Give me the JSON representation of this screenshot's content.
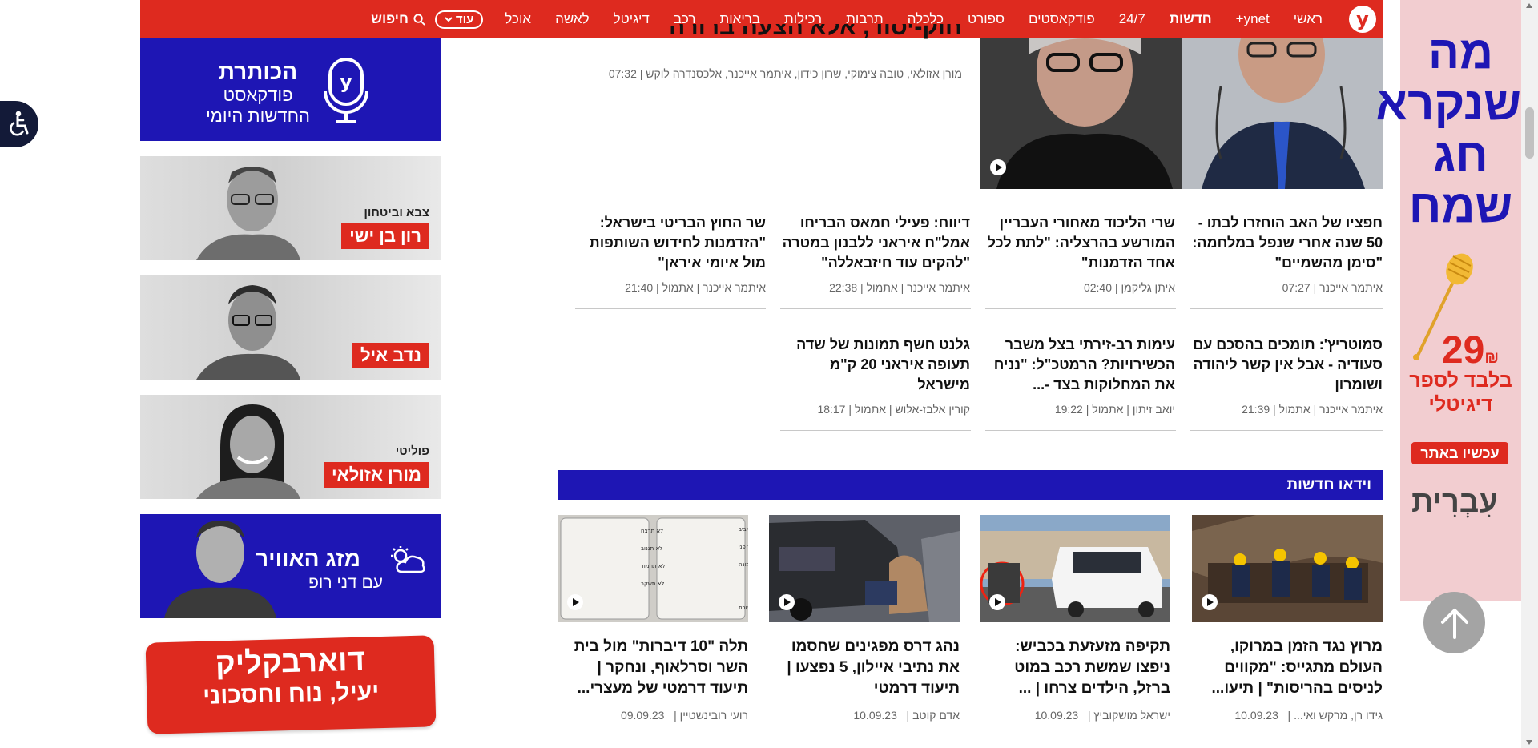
{
  "nav": {
    "logo": "y",
    "items": [
      "ראשי",
      "ynet+",
      "חדשות",
      "24/7",
      "פודקאסטים",
      "ספורט",
      "כלכלה",
      "תרבות",
      "רכילות",
      "בריאות",
      "רכב",
      "דיגיטל",
      "לאשה",
      "אוכל"
    ],
    "more": "עוד",
    "search": "חיפוש"
  },
  "lead": {
    "title": "חוק-יסוד, אלא הצעה ברורה",
    "authors": "מורן אזולאי, טובה צימוקי, שרון כידון, איתמר אייכנר, אלכסנדרה לוקש | 07:32"
  },
  "articles": [
    {
      "title": "חפציו של האב הוחזרו לבתו - 50 שנה אחרי שנפל במלחמה: \"סימן מהשמיים\"",
      "author": "איתמר אייכנר",
      "time": "07:27"
    },
    {
      "title": "שרי הליכוד מאחורי העבריין המורשע בהרצליה: \"לתת לכל אחד הזדמנות\"",
      "author": "איתן גליקמן",
      "time": "02:40"
    },
    {
      "title": "דיווח: פעילי חמאס הבריחו אמל\"ח איראני ללבנון במטרה \"להקים עוד חיזבאללה\"",
      "author": "איתמר אייכנר | אתמול",
      "time": "22:38"
    },
    {
      "title": "שר החוץ הבריטי בישראל: \"הזדמנות לחידוש השותפות מול איומי איראן\"",
      "author": "איתמר אייכנר | אתמול",
      "time": "21:40"
    },
    {
      "title": "סמוטריץ': תומכים בהסכם עם סעודיה - אבל אין קשר ליהודה ושומרון",
      "author": "איתמר אייכנר | אתמול",
      "time": "21:39"
    },
    {
      "title": "עימות רב-זירתי בצל משבר הכשירויות? הרמטכ\"ל: \"נניח את המחלוקות בצד -...",
      "author": "יואב זיתון | אתמול",
      "time": "19:22"
    },
    {
      "title": "גלנט חשף תמונות של שדה תעופה איראני 20 ק\"מ מישראל",
      "author": "קורין אלבז-אלוש | אתמול",
      "time": "18:17"
    }
  ],
  "video_section": {
    "title": "וידאו חדשות"
  },
  "videos": [
    {
      "title": "מרוץ נגד הזמן במרוקו, העולם מתגייס: \"מקווים לניסים בהריסות\" | תיעו...",
      "author": "גידו רן, מרקש ואי...",
      "date": "10.09.23"
    },
    {
      "title": "תקיפה מזעזעת בכביש: ניפצו שמשת רכב במוט ברזל, הילדים צרחו | ...",
      "author": "ישראל מושקוביץ",
      "date": "10.09.23"
    },
    {
      "title": "נהג דרס מפגינים שחסמו את נתיבי איילון, 5 נפצעו | תיעוד דרמטי",
      "author": "אדם קוטב",
      "date": "10.09.23"
    },
    {
      "title": "תלה \"10 דיברות\" מול בית השר וסרלאוף, ונחקר | תיעוד דרמטי של מעצרי...",
      "author": "רועי רובינשטיין",
      "date": "09.09.23"
    }
  ],
  "video_sign": {
    "left_lines": [
      "לא תרצח",
      "לא תגנוב",
      "לא תחמוד",
      "לא תשקר"
    ],
    "right_lines": [
      "אנוכי הצמון חייך, תל אביב",
      "לא יהיה לך משך אחד על פני",
      "עשה לך פסל ותמונה",
      "זכור את יום השבת"
    ]
  },
  "sidebar": {
    "podcast": {
      "title": "הכותרת",
      "line2": "פודקאסט",
      "line3": "החדשות היומי"
    },
    "columnists": [
      {
        "category": "צבא וביטחון",
        "name": "רון בן ישי"
      },
      {
        "category": "",
        "name": "נדב איל"
      },
      {
        "category": "פוליטי",
        "name": "מורן אזולאי"
      }
    ],
    "weather": {
      "title": "מזג האוויר",
      "subtitle": "עם דני רופ"
    },
    "dvr": {
      "line1": "דוארבקליק",
      "line2": "יעיל, נוח וחסכוני"
    }
  },
  "ad": {
    "headline": "מה שנקרא חג שמח",
    "price": "29",
    "currency": "₪",
    "sub": "בלבד לספר דיגיטלי",
    "button": "עכשיו באתר",
    "brand": "עִבְרִית"
  },
  "colors": {
    "brand_red": "#de2a1f",
    "brand_blue": "#1e16b4",
    "ad_pink": "#f2cdd0"
  }
}
